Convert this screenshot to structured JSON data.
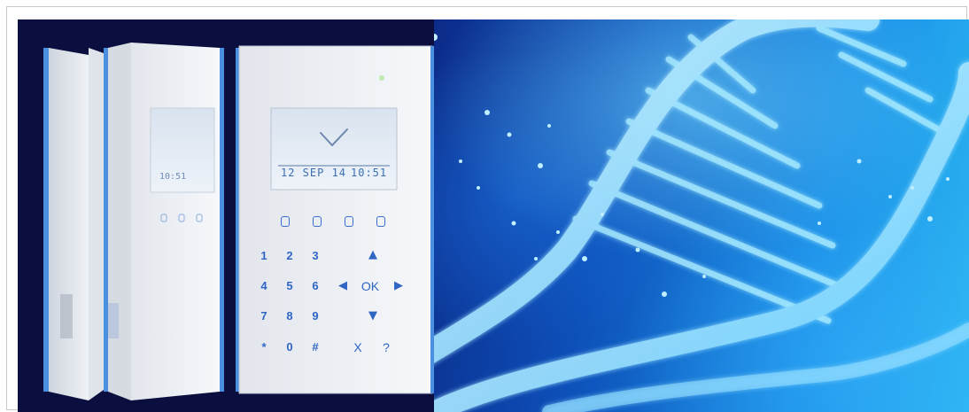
{
  "banner": {
    "keypad": {
      "lcd_date": "12 SEP 14",
      "lcd_time": "10:51",
      "rear_lcd_text": "10:51",
      "ok_label": "OK",
      "keys": [
        {
          "label": "1"
        },
        {
          "label": "2"
        },
        {
          "label": "3"
        },
        {
          "label": "4"
        },
        {
          "label": "5"
        },
        {
          "label": "6"
        },
        {
          "label": "7"
        },
        {
          "label": "8"
        },
        {
          "label": "9"
        },
        {
          "label": "*"
        },
        {
          "label": "0"
        },
        {
          "label": "#"
        }
      ],
      "x_label": "X",
      "help_label": "?"
    }
  },
  "colors": {
    "background_dark": "#070b3e",
    "background_light": "#2bb6f2",
    "dna": "#9fe6ff",
    "keypad_body": "#eef1f5",
    "key_text": "#2f66c4",
    "edge_blue": "#4a8fe0"
  }
}
